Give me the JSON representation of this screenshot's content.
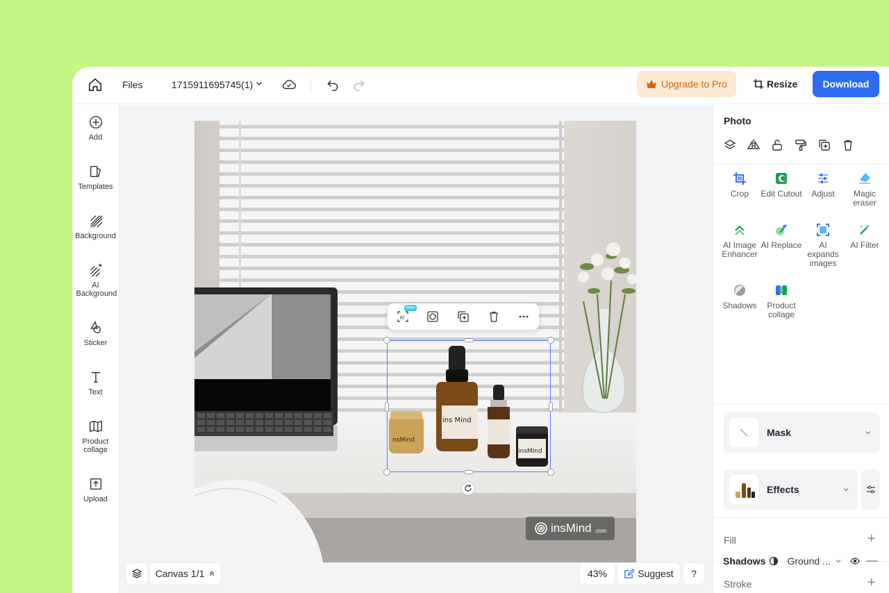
{
  "topbar": {
    "files_label": "Files",
    "doc_name": "1715911695745(1)",
    "upgrade_label": "Upgrade to Pro",
    "resize_label": "Resize",
    "download_label": "Download"
  },
  "sidebar": {
    "items": [
      {
        "label": "Add",
        "icon": "plus-circle-icon"
      },
      {
        "label": "Templates",
        "icon": "templates-icon"
      },
      {
        "label": "Background",
        "icon": "background-icon"
      },
      {
        "label": "AI Background",
        "icon": "ai-background-icon"
      },
      {
        "label": "Sticker",
        "icon": "sticker-icon"
      },
      {
        "label": "Text",
        "icon": "text-icon"
      },
      {
        "label": "Product collage",
        "icon": "product-collage-icon"
      },
      {
        "label": "Upload",
        "icon": "upload-icon"
      }
    ]
  },
  "canvas": {
    "new_badge": "New",
    "watermark_brand": "insMind",
    "watermark_suffix": ".com",
    "jar_label_1": "ins Mind",
    "jar_label_2": "insMind",
    "jar_label_3": "nsMind"
  },
  "bottombar": {
    "canvas_label": "Canvas 1/1",
    "zoom": "43%",
    "suggest_label": "Suggest",
    "help_label": "?"
  },
  "panel": {
    "title": "Photo",
    "tools": [
      {
        "label": "Crop"
      },
      {
        "label": "Edit Cutout"
      },
      {
        "label": "Adjust"
      },
      {
        "label": "Magic eraser"
      },
      {
        "label": "AI Image Enhancer"
      },
      {
        "label": "AI Replace"
      },
      {
        "label": "AI expands images"
      },
      {
        "label": "AI Filter"
      },
      {
        "label": "Shadows"
      },
      {
        "label": "Product collage"
      }
    ],
    "mask_label": "Mask",
    "effects_label": "Effects",
    "fill_label": "Fill",
    "stroke_label": "Stroke",
    "shadows_label": "Shadows",
    "shadow_type": "Ground ..."
  },
  "colors": {
    "accent": "#2d6bf0",
    "upgrade_bg": "#fde9d4",
    "upgrade_text": "#d06a14",
    "frame_green": "#c4f786"
  }
}
